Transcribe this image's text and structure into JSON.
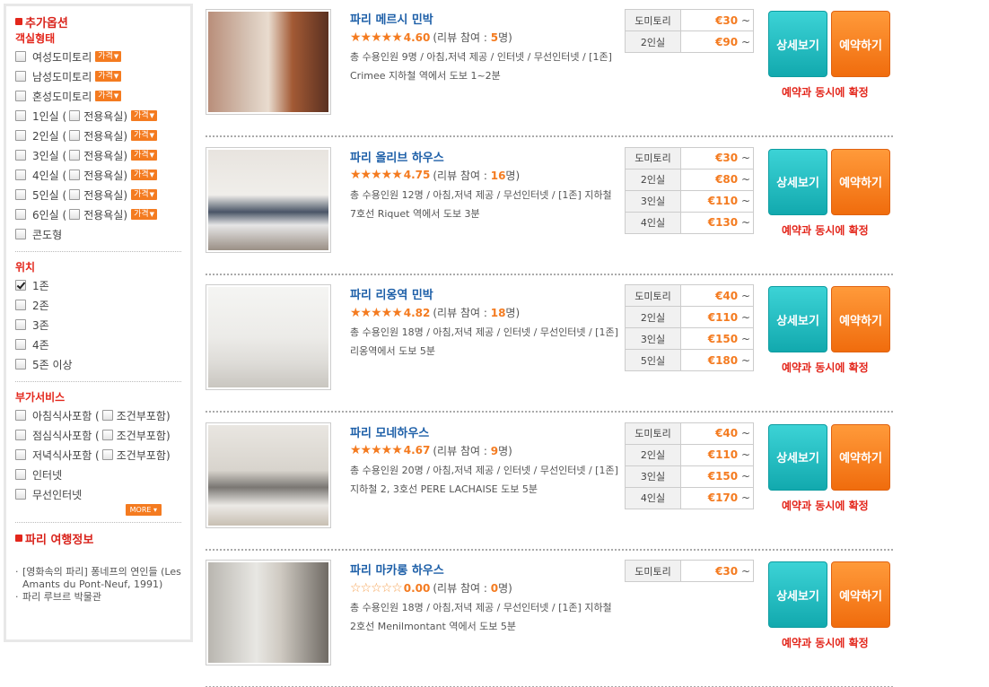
{
  "sidebar": {
    "title": "추가옵션",
    "room_type": {
      "title": "객실형태",
      "price_label": "가격",
      "items": [
        {
          "label": "여성도미토리",
          "checked": false
        },
        {
          "label": "남성도미토리",
          "checked": false
        },
        {
          "label": "혼성도미토리",
          "checked": false
        },
        {
          "label": "1인실 (",
          "bath": "전용욕실)",
          "checked": false
        },
        {
          "label": "2인실 (",
          "bath": "전용욕실)",
          "checked": false
        },
        {
          "label": "3인실 (",
          "bath": "전용욕실)",
          "checked": false
        },
        {
          "label": "4인실 (",
          "bath": "전용욕실)",
          "checked": false
        },
        {
          "label": "5인실 (",
          "bath": "전용욕실)",
          "checked": false
        },
        {
          "label": "6인실 (",
          "bath": "전용욕실)",
          "checked": false
        },
        {
          "label": "콘도형",
          "checked": false
        }
      ]
    },
    "location": {
      "title": "위치",
      "items": [
        {
          "label": "1존",
          "checked": true
        },
        {
          "label": "2존",
          "checked": false
        },
        {
          "label": "3존",
          "checked": false
        },
        {
          "label": "4존",
          "checked": false
        },
        {
          "label": "5존 이상",
          "checked": false
        }
      ]
    },
    "services": {
      "title": "부가서비스",
      "items": [
        {
          "label": "아침식사포함 (",
          "sub": "조건부포함)"
        },
        {
          "label": "점심식사포함 (",
          "sub": "조건부포함)"
        },
        {
          "label": "저녁식사포함 (",
          "sub": "조건부포함)"
        },
        {
          "label": "인터넷"
        },
        {
          "label": "무선인터넷"
        }
      ],
      "more_label": "MORE ▾"
    },
    "travel": {
      "title": "파리 여행정보",
      "items": [
        "[영화속의 파리] 퐁네프의 연인들 (Les Amants du Pont-Neuf, 1991)",
        "파리 루브르 박물관"
      ]
    }
  },
  "listings": [
    {
      "name": "파리 메르시 민박",
      "stars": "★★★★★",
      "score": "4.60",
      "reviews_prefix": "(리뷰 참여 : ",
      "reviews_count": "5",
      "reviews_suffix": "명)",
      "desc": "총 수용인원 9명 / 아침,저녁 제공 / 인터넷 / 무선인터넷 / [1존] Crimee 지하철 역에서 도보 1~2분",
      "prices": [
        [
          "도미토리",
          "€30"
        ],
        [
          "2인실",
          "€90"
        ]
      ],
      "detail": "상세보기",
      "book": "예약하기",
      "confirm": "예약과 동시에 확정"
    },
    {
      "name": "파리 올리브 하우스",
      "stars": "★★★★★",
      "score": "4.75",
      "reviews_prefix": "(리뷰 참여 : ",
      "reviews_count": "16",
      "reviews_suffix": "명)",
      "desc": "총 수용인원 12명 / 아침,저녁 제공 / 무선인터넷 / [1존] 지하철 7호선 Riquet 역에서 도보 3분",
      "prices": [
        [
          "도미토리",
          "€30"
        ],
        [
          "2인실",
          "€80"
        ],
        [
          "3인실",
          "€110"
        ],
        [
          "4인실",
          "€130"
        ]
      ],
      "detail": "상세보기",
      "book": "예약하기",
      "confirm": "예약과 동시에 확정"
    },
    {
      "name": "파리 리옹역 민박",
      "stars": "★★★★★",
      "score": "4.82",
      "reviews_prefix": "(리뷰 참여 : ",
      "reviews_count": "18",
      "reviews_suffix": "명)",
      "desc": "총 수용인원 18명 / 아침,저녁 제공 / 인터넷 / 무선인터넷 / [1존] 리옹역에서 도보 5분",
      "prices": [
        [
          "도미토리",
          "€40"
        ],
        [
          "2인실",
          "€110"
        ],
        [
          "3인실",
          "€150"
        ],
        [
          "5인실",
          "€180"
        ]
      ],
      "detail": "상세보기",
      "book": "예약하기",
      "confirm": "예약과 동시에 확정"
    },
    {
      "name": "파리 모네하우스",
      "stars": "★★★★★",
      "score": "4.67",
      "reviews_prefix": "(리뷰 참여 : ",
      "reviews_count": "9",
      "reviews_suffix": "명)",
      "desc": "총 수용인원 20명 / 아침,저녁 제공 / 인터넷 / 무선인터넷 / [1존] 지하철 2, 3호선 PERE LACHAISE 도보 5분",
      "prices": [
        [
          "도미토리",
          "€40"
        ],
        [
          "2인실",
          "€110"
        ],
        [
          "3인실",
          "€150"
        ],
        [
          "4인실",
          "€170"
        ]
      ],
      "detail": "상세보기",
      "book": "예약하기",
      "confirm": "예약과 동시에 확정"
    },
    {
      "name": "파리 마카롱 하우스",
      "stars": "☆☆☆☆☆",
      "score": "0.00",
      "reviews_prefix": "(리뷰 참여 : ",
      "reviews_count": "0",
      "reviews_suffix": "명)",
      "desc": "총 수용인원 18명 / 아침,저녁 제공 / 무선인터넷 / [1존] 지하철 2호선 Menilmontant 역에서 도보 5분",
      "prices": [
        [
          "도미토리",
          "€30"
        ]
      ],
      "detail": "상세보기",
      "book": "예약하기",
      "confirm": "예약과 동시에 확정"
    }
  ],
  "price_suffix": "~",
  "colors": {
    "accent_orange": "#f47b20",
    "accent_red": "#e3261b",
    "link_blue": "#1d5fa8",
    "detail_teal": "#12a9ae"
  }
}
